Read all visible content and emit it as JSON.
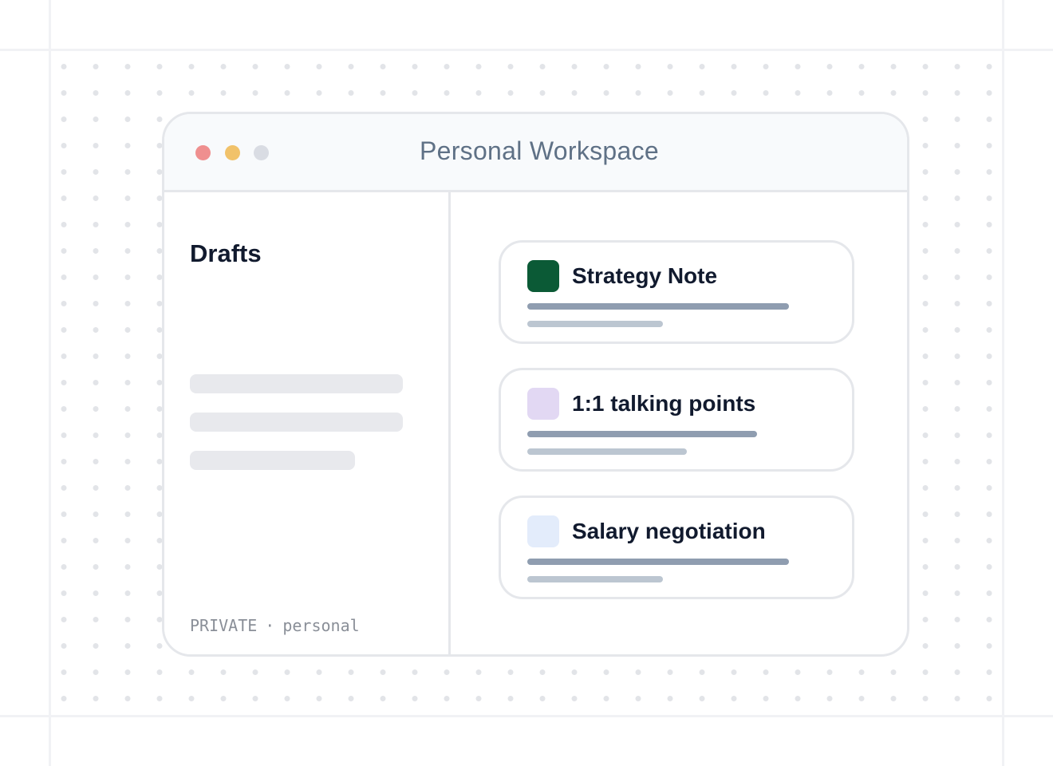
{
  "window": {
    "title": "Personal Workspace",
    "traffic_lights": [
      {
        "name": "close",
        "color": "#ef8f8f"
      },
      {
        "name": "minimize",
        "color": "#f1c26a"
      },
      {
        "name": "maximize",
        "color": "#d9dce3"
      }
    ]
  },
  "sidebar": {
    "title": "Drafts",
    "footer": {
      "label": "PRIVATE",
      "separator": "·",
      "value": "personal"
    }
  },
  "cards": [
    {
      "title": "Strategy Note",
      "icon": "square-icon",
      "icon_color": "#0b5a36"
    },
    {
      "title": "1:1 talking points",
      "icon": "square-icon",
      "icon_color": "#e2d8f3"
    },
    {
      "title": "Salary negotiation",
      "icon": "square-icon",
      "icon_color": "#e3ecfb"
    }
  ]
}
